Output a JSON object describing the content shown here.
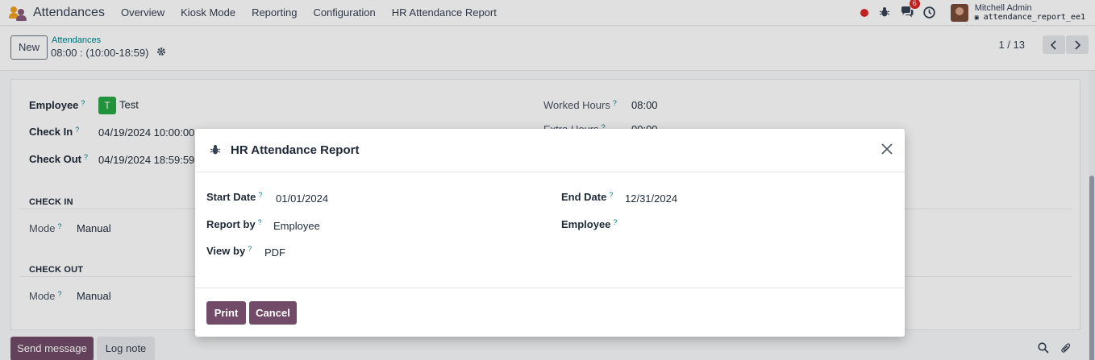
{
  "navbar": {
    "app_name": "Attendances",
    "menu": [
      "Overview",
      "Kiosk Mode",
      "Reporting",
      "Configuration",
      "HR Attendance Report"
    ],
    "chat_badge": "6",
    "user_name": "Mitchell Admin",
    "database": "attendance_report_ee1",
    "icons": [
      "recording-indicator",
      "bug-icon",
      "chat-icon",
      "clock-icon"
    ]
  },
  "control": {
    "new_label": "New",
    "breadcrumb": "Attendances",
    "record_name": "08:00 : (10:00-18:59)",
    "pager": "1 / 13"
  },
  "form": {
    "employee_label": "Employee",
    "employee_initial": "T",
    "employee_value": "Test",
    "check_in_label": "Check In",
    "check_in_value": "04/19/2024 10:00:00",
    "check_out_label": "Check Out",
    "check_out_value": "04/19/2024 18:59:59",
    "worked_hours_label": "Worked Hours",
    "worked_hours_value": "08:00",
    "extra_hours_label": "Extra Hours",
    "extra_hours_value": "00:00",
    "section_check_in": "CHECK IN",
    "section_check_out": "CHECK OUT",
    "mode_label": "Mode",
    "mode_in_value": "Manual",
    "mode_out_value": "Manual"
  },
  "chatter": {
    "send_message": "Send message",
    "log_note": "Log note"
  },
  "modal": {
    "title": "HR Attendance Report",
    "start_date_label": "Start Date",
    "start_date_value": "01/01/2024",
    "end_date_label": "End Date",
    "end_date_value": "12/31/2024",
    "report_by_label": "Report by",
    "report_by_value": "Employee",
    "employee_label": "Employee",
    "employee_value": "",
    "view_by_label": "View by",
    "view_by_value": "PDF",
    "print_label": "Print",
    "cancel_label": "Cancel"
  },
  "colors": {
    "primary": "#714b67",
    "link": "#017e84",
    "employee_badge": "#28a745",
    "alert": "#dc2626"
  },
  "help_mark": "?"
}
